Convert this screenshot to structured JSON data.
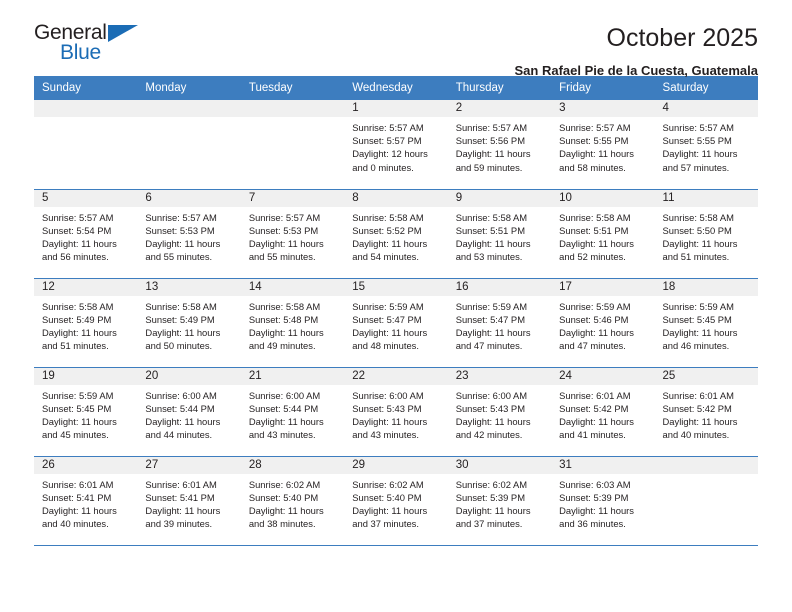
{
  "brand": {
    "name_top": "General",
    "name_bottom": "Blue",
    "triangle_color": "#1b6cb5"
  },
  "header": {
    "title": "October 2025",
    "subtitle": "San Rafael Pie de la Cuesta, Guatemala"
  },
  "theme": {
    "header_bg": "#3d7dbf",
    "header_text": "#ffffff",
    "daynum_bg": "#f0f0f0",
    "text": "#231f20"
  },
  "calendar": {
    "weekday_headers": [
      "Sunday",
      "Monday",
      "Tuesday",
      "Wednesday",
      "Thursday",
      "Friday",
      "Saturday"
    ],
    "weeks": [
      [
        {
          "day": "",
          "lines": []
        },
        {
          "day": "",
          "lines": []
        },
        {
          "day": "",
          "lines": []
        },
        {
          "day": "1",
          "lines": [
            "Sunrise: 5:57 AM",
            "Sunset: 5:57 PM",
            "Daylight: 12 hours",
            "and 0 minutes."
          ]
        },
        {
          "day": "2",
          "lines": [
            "Sunrise: 5:57 AM",
            "Sunset: 5:56 PM",
            "Daylight: 11 hours",
            "and 59 minutes."
          ]
        },
        {
          "day": "3",
          "lines": [
            "Sunrise: 5:57 AM",
            "Sunset: 5:55 PM",
            "Daylight: 11 hours",
            "and 58 minutes."
          ]
        },
        {
          "day": "4",
          "lines": [
            "Sunrise: 5:57 AM",
            "Sunset: 5:55 PM",
            "Daylight: 11 hours",
            "and 57 minutes."
          ]
        }
      ],
      [
        {
          "day": "5",
          "lines": [
            "Sunrise: 5:57 AM",
            "Sunset: 5:54 PM",
            "Daylight: 11 hours",
            "and 56 minutes."
          ]
        },
        {
          "day": "6",
          "lines": [
            "Sunrise: 5:57 AM",
            "Sunset: 5:53 PM",
            "Daylight: 11 hours",
            "and 55 minutes."
          ]
        },
        {
          "day": "7",
          "lines": [
            "Sunrise: 5:57 AM",
            "Sunset: 5:53 PM",
            "Daylight: 11 hours",
            "and 55 minutes."
          ]
        },
        {
          "day": "8",
          "lines": [
            "Sunrise: 5:58 AM",
            "Sunset: 5:52 PM",
            "Daylight: 11 hours",
            "and 54 minutes."
          ]
        },
        {
          "day": "9",
          "lines": [
            "Sunrise: 5:58 AM",
            "Sunset: 5:51 PM",
            "Daylight: 11 hours",
            "and 53 minutes."
          ]
        },
        {
          "day": "10",
          "lines": [
            "Sunrise: 5:58 AM",
            "Sunset: 5:51 PM",
            "Daylight: 11 hours",
            "and 52 minutes."
          ]
        },
        {
          "day": "11",
          "lines": [
            "Sunrise: 5:58 AM",
            "Sunset: 5:50 PM",
            "Daylight: 11 hours",
            "and 51 minutes."
          ]
        }
      ],
      [
        {
          "day": "12",
          "lines": [
            "Sunrise: 5:58 AM",
            "Sunset: 5:49 PM",
            "Daylight: 11 hours",
            "and 51 minutes."
          ]
        },
        {
          "day": "13",
          "lines": [
            "Sunrise: 5:58 AM",
            "Sunset: 5:49 PM",
            "Daylight: 11 hours",
            "and 50 minutes."
          ]
        },
        {
          "day": "14",
          "lines": [
            "Sunrise: 5:58 AM",
            "Sunset: 5:48 PM",
            "Daylight: 11 hours",
            "and 49 minutes."
          ]
        },
        {
          "day": "15",
          "lines": [
            "Sunrise: 5:59 AM",
            "Sunset: 5:47 PM",
            "Daylight: 11 hours",
            "and 48 minutes."
          ]
        },
        {
          "day": "16",
          "lines": [
            "Sunrise: 5:59 AM",
            "Sunset: 5:47 PM",
            "Daylight: 11 hours",
            "and 47 minutes."
          ]
        },
        {
          "day": "17",
          "lines": [
            "Sunrise: 5:59 AM",
            "Sunset: 5:46 PM",
            "Daylight: 11 hours",
            "and 47 minutes."
          ]
        },
        {
          "day": "18",
          "lines": [
            "Sunrise: 5:59 AM",
            "Sunset: 5:45 PM",
            "Daylight: 11 hours",
            "and 46 minutes."
          ]
        }
      ],
      [
        {
          "day": "19",
          "lines": [
            "Sunrise: 5:59 AM",
            "Sunset: 5:45 PM",
            "Daylight: 11 hours",
            "and 45 minutes."
          ]
        },
        {
          "day": "20",
          "lines": [
            "Sunrise: 6:00 AM",
            "Sunset: 5:44 PM",
            "Daylight: 11 hours",
            "and 44 minutes."
          ]
        },
        {
          "day": "21",
          "lines": [
            "Sunrise: 6:00 AM",
            "Sunset: 5:44 PM",
            "Daylight: 11 hours",
            "and 43 minutes."
          ]
        },
        {
          "day": "22",
          "lines": [
            "Sunrise: 6:00 AM",
            "Sunset: 5:43 PM",
            "Daylight: 11 hours",
            "and 43 minutes."
          ]
        },
        {
          "day": "23",
          "lines": [
            "Sunrise: 6:00 AM",
            "Sunset: 5:43 PM",
            "Daylight: 11 hours",
            "and 42 minutes."
          ]
        },
        {
          "day": "24",
          "lines": [
            "Sunrise: 6:01 AM",
            "Sunset: 5:42 PM",
            "Daylight: 11 hours",
            "and 41 minutes."
          ]
        },
        {
          "day": "25",
          "lines": [
            "Sunrise: 6:01 AM",
            "Sunset: 5:42 PM",
            "Daylight: 11 hours",
            "and 40 minutes."
          ]
        }
      ],
      [
        {
          "day": "26",
          "lines": [
            "Sunrise: 6:01 AM",
            "Sunset: 5:41 PM",
            "Daylight: 11 hours",
            "and 40 minutes."
          ]
        },
        {
          "day": "27",
          "lines": [
            "Sunrise: 6:01 AM",
            "Sunset: 5:41 PM",
            "Daylight: 11 hours",
            "and 39 minutes."
          ]
        },
        {
          "day": "28",
          "lines": [
            "Sunrise: 6:02 AM",
            "Sunset: 5:40 PM",
            "Daylight: 11 hours",
            "and 38 minutes."
          ]
        },
        {
          "day": "29",
          "lines": [
            "Sunrise: 6:02 AM",
            "Sunset: 5:40 PM",
            "Daylight: 11 hours",
            "and 37 minutes."
          ]
        },
        {
          "day": "30",
          "lines": [
            "Sunrise: 6:02 AM",
            "Sunset: 5:39 PM",
            "Daylight: 11 hours",
            "and 37 minutes."
          ]
        },
        {
          "day": "31",
          "lines": [
            "Sunrise: 6:03 AM",
            "Sunset: 5:39 PM",
            "Daylight: 11 hours",
            "and 36 minutes."
          ]
        },
        {
          "day": "",
          "lines": []
        }
      ]
    ]
  }
}
